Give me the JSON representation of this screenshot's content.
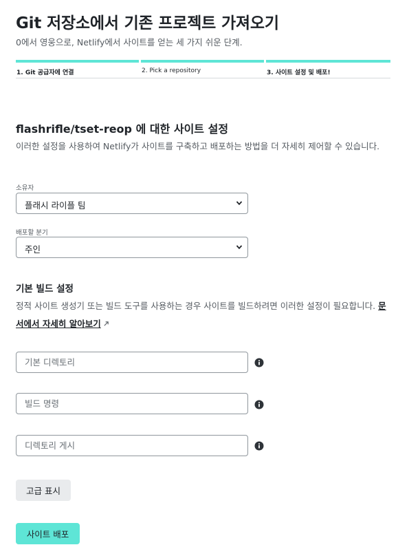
{
  "header": {
    "title": "Git 저장소에서 기존 프로젝트 가져오기",
    "subtitle": "0에서 영웅으로, Netlify에서 사이트를 얻는 세 가지 쉬운 단계."
  },
  "steps": [
    {
      "label": "1. Git 공급자에 연결"
    },
    {
      "label": "2. Pick a repository"
    },
    {
      "label": "3. 사이트 설정 및 배포!"
    }
  ],
  "site_settings": {
    "title_repo": "flashrifle/tset-reop",
    "title_suffix": " 에 대한 사이트 설정",
    "description": "이러한 설정을 사용하여 Netlify가 사이트를 구축하고 배포하는 방법을 더 자세히 제어할 수 있습니다."
  },
  "owner": {
    "label": "소유자",
    "value": "플래시 라이플 팀"
  },
  "branch": {
    "label": "배포할 분기",
    "value": "주인"
  },
  "build": {
    "title": "기본 빌드 설정",
    "description": "정적 사이트 생성기 또는 빌드 도구를 사용하는 경우 사이트를 빌드하려면 이러한 설정이 필요합니다. ",
    "docs_link": "문서에서 자세히 알아보기",
    "base_dir_placeholder": "기본 디렉토리",
    "command_placeholder": "빌드 명령",
    "publish_dir_placeholder": "디렉토리 게시"
  },
  "actions": {
    "advanced_label": "고급 표시",
    "deploy_label": "사이트 배포"
  },
  "colors": {
    "accent": "#5ee5d6",
    "text": "#1f2328",
    "muted": "#555b61"
  }
}
